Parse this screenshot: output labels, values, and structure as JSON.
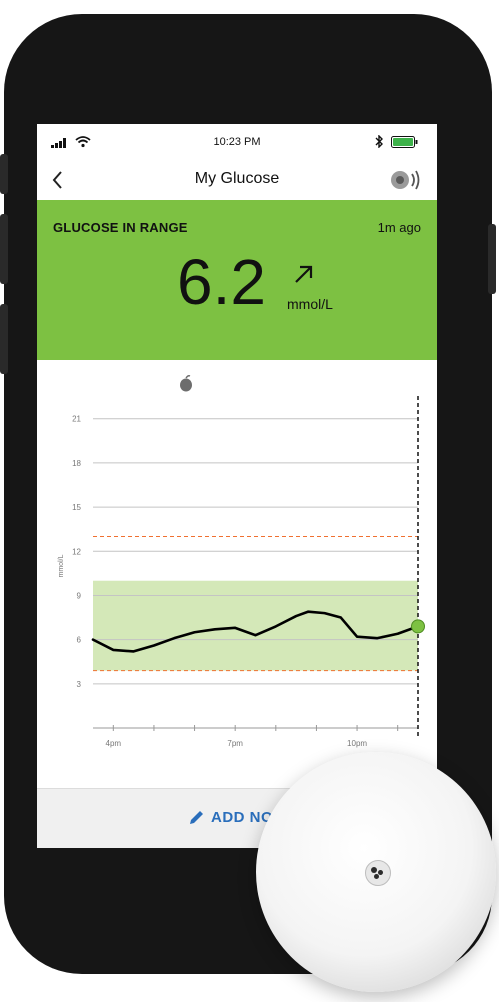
{
  "status_bar": {
    "time": "10:23 PM"
  },
  "nav": {
    "title": "My Glucose",
    "back_icon": "chevron-left-icon",
    "sound_icon": "speaker-icon"
  },
  "banner": {
    "status": "GLUCOSE IN RANGE",
    "updated": "1m ago",
    "value": "6.2",
    "unit": "mmol/L",
    "trend_icon": "arrow-up-right-icon",
    "color": "#7dc142"
  },
  "chart_data": {
    "type": "line",
    "ylabel": "mmol/L",
    "ylim": [
      0,
      22
    ],
    "yticks": [
      3,
      6,
      9,
      12,
      15,
      18,
      21
    ],
    "xticks": [
      "4pm",
      "7pm",
      "10pm"
    ],
    "x_range_hours": [
      15.5,
      23.5
    ],
    "target_range": [
      3.9,
      10.0
    ],
    "alert_lines": [
      3.9,
      13.0
    ],
    "current_time": 23.5,
    "current_marker_icon": "apple-icon",
    "series": [
      {
        "x": [
          15.5,
          16.0,
          16.5,
          17.0,
          17.5,
          18.0,
          18.5,
          19.0,
          19.5,
          20.0,
          20.5,
          20.8,
          21.2,
          21.6,
          22.0,
          22.5,
          23.0,
          23.5
        ],
        "values": [
          6.0,
          5.3,
          5.2,
          5.6,
          6.1,
          6.5,
          6.7,
          6.8,
          6.3,
          6.9,
          7.6,
          7.9,
          7.8,
          7.5,
          6.2,
          6.1,
          6.4,
          6.9
        ]
      }
    ],
    "colors": {
      "line": "#000000",
      "range_fill": "#d4e8b8",
      "alert": "#f07030",
      "current_dot": "#7dc142"
    }
  },
  "footer": {
    "add_note_label": "ADD NOTE",
    "pencil_icon": "pencil-icon"
  },
  "sensor": {
    "icon": "sensor-icon"
  }
}
